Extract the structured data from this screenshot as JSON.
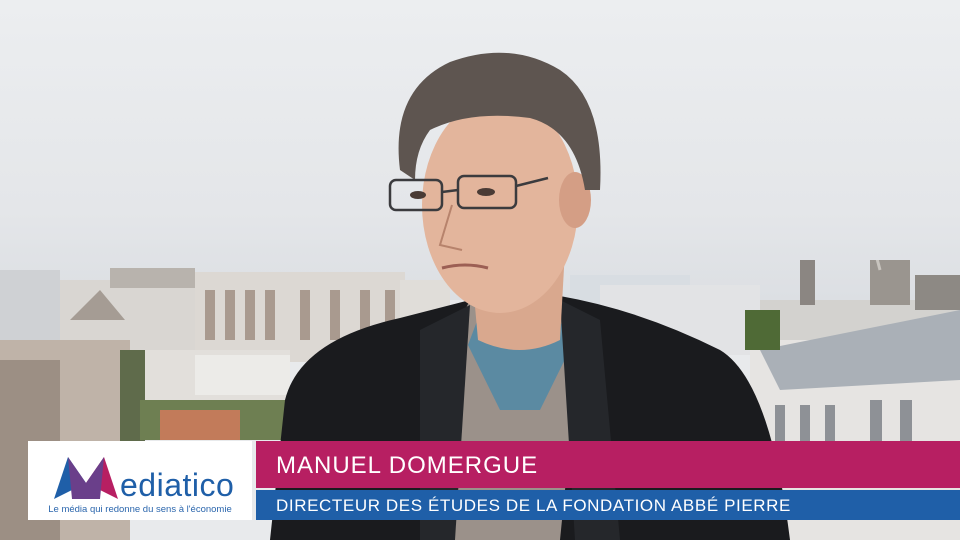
{
  "lower_third": {
    "name": "MANUEL DOMERGUE",
    "title": "DIRECTEUR DES ÉTUDES DE LA FONDATION ABBÉ PIERRE",
    "name_bar_color": "#b71f62",
    "title_bar_color": "#1f5fa8"
  },
  "logo": {
    "wordmark": "ediatico",
    "tagline": "Le média qui redonne du sens à l'économie",
    "mark_icon": "mediatico-m-logo-icon"
  }
}
